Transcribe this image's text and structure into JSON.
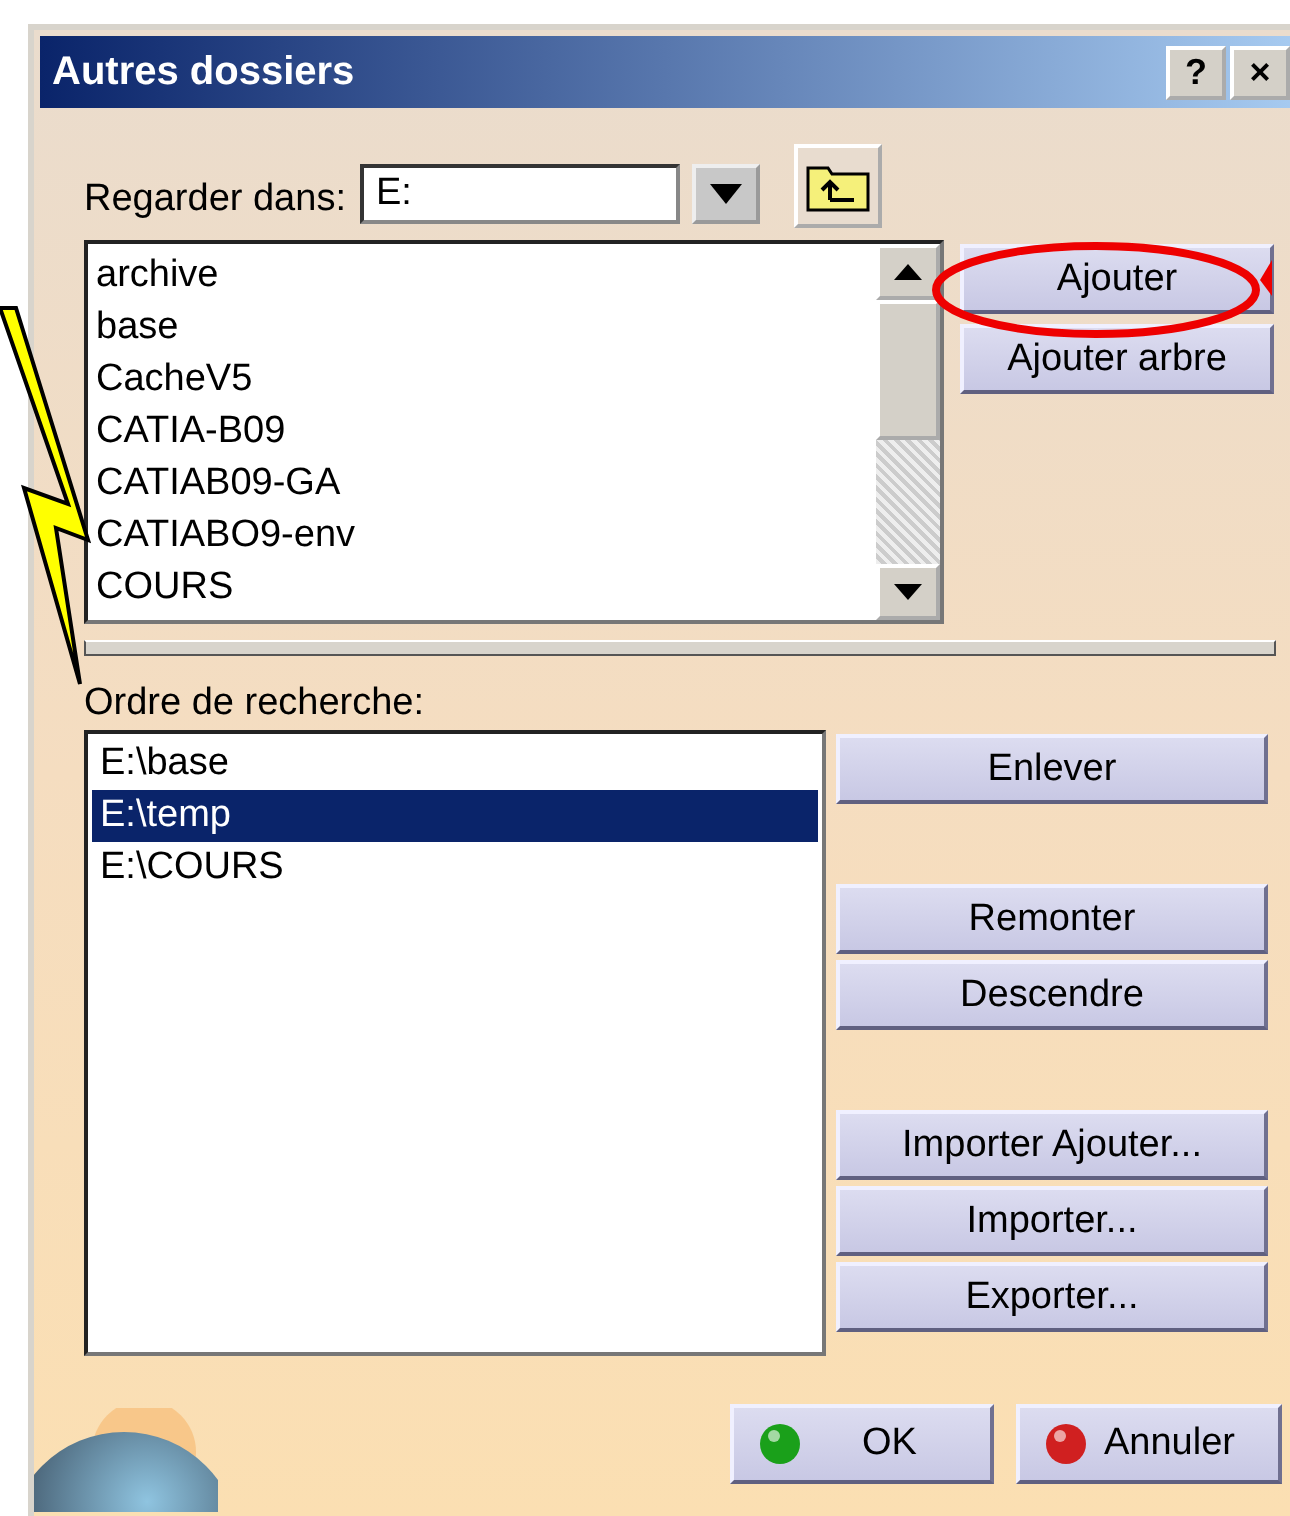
{
  "window": {
    "title": "Autres dossiers",
    "help_button": "?",
    "close_button": "×"
  },
  "look_in": {
    "label": "Regarder dans:",
    "value": "E:"
  },
  "folders": [
    "archive",
    "base",
    "CacheV5",
    "CATIA-B09",
    "CATIAB09-GA",
    "CATIABO9-env",
    "COURS"
  ],
  "folder_buttons": [
    "Ajouter",
    "Ajouter arbre"
  ],
  "search_order": {
    "label": "Ordre de recherche:",
    "items": [
      {
        "text": "E:\\base",
        "selected": false
      },
      {
        "text": "E:\\temp",
        "selected": true
      },
      {
        "text": "E:\\COURS",
        "selected": false
      }
    ]
  },
  "order_button_groups": [
    {
      "buttons": [
        "Enlever"
      ]
    },
    {
      "buttons": [
        "Remonter",
        "Descendre"
      ]
    },
    {
      "buttons": [
        "Importer Ajouter...",
        "Importer...",
        "Exporter..."
      ]
    }
  ],
  "dialog_buttons": [
    {
      "label": "OK",
      "kind": "ok"
    },
    {
      "label": "Annuler",
      "kind": "cancel"
    }
  ]
}
